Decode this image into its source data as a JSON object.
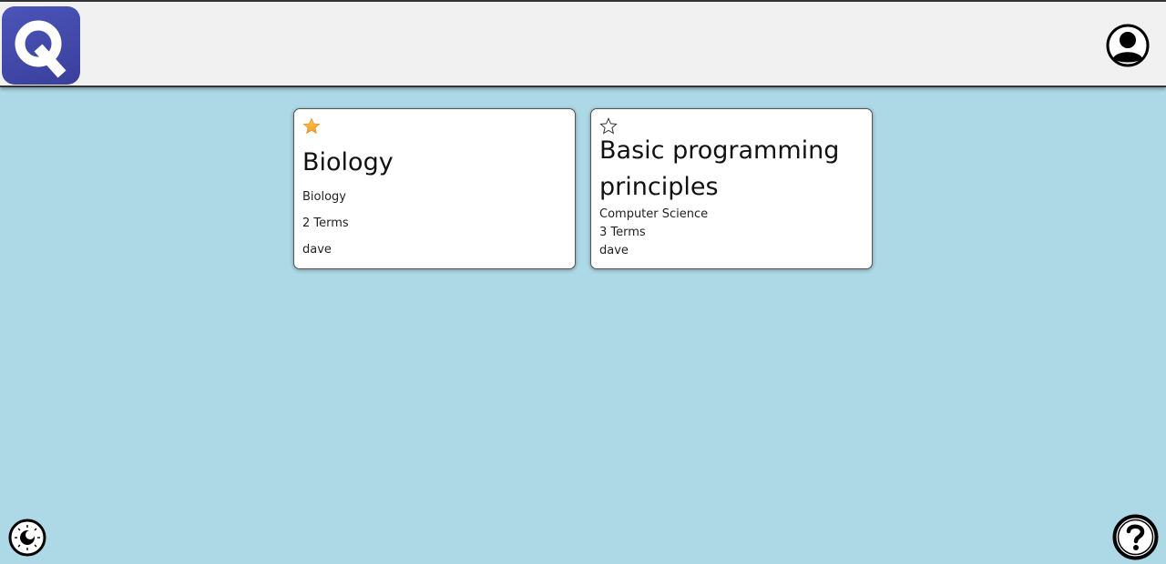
{
  "app": {
    "logo_letter": "Q",
    "brand_color": "#434bae"
  },
  "header": {
    "avatar_icon": "user-circle-icon"
  },
  "sets": [
    {
      "title": "Biology",
      "subject": "Biology",
      "terms": "2 Terms",
      "author": "dave",
      "favorited": true
    },
    {
      "title": "Basic programming principles",
      "subject": "Computer Science",
      "terms": "3 Terms",
      "author": "dave",
      "favorited": false
    }
  ],
  "footer": {
    "theme_icon": "theme-toggle-icon",
    "help_icon": "help-icon"
  },
  "colors": {
    "background": "#add8e6",
    "header": "#f1f1f1",
    "star_filled": "#f4a93a"
  }
}
